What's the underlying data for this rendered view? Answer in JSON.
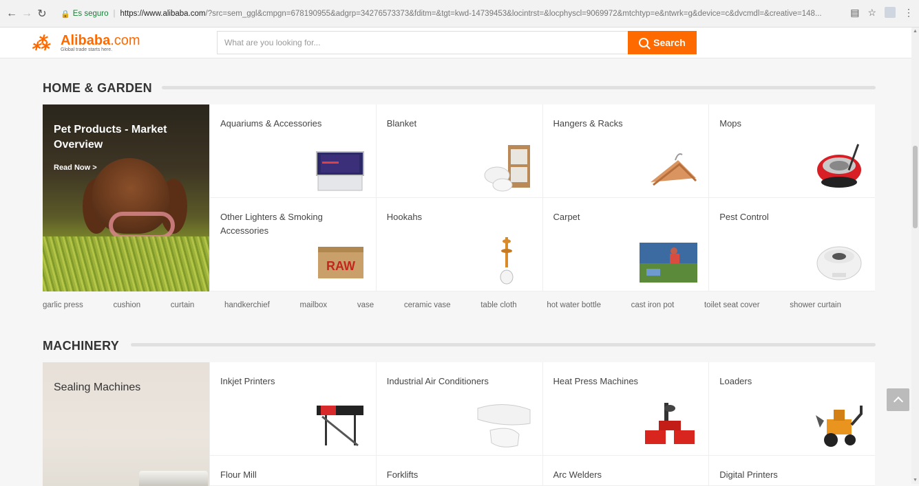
{
  "browser": {
    "secure_label": "Es seguro",
    "url_host": "https://www.alibaba.com",
    "url_rest": "/?src=sem_ggl&cmpgn=678190955&adgrp=34276573373&fditm=&tgt=kwd-14739453&locintrst=&locphyscl=9069972&mtchtyp=e&ntwrk=g&device=c&dvcmdl=&creative=148..."
  },
  "header": {
    "logo_name": "Alibaba",
    "logo_suffix": ".com",
    "logo_tagline": "Global trade starts here.",
    "search_placeholder": "What are you looking for...",
    "search_label": "Search"
  },
  "home_garden": {
    "title": "HOME & GARDEN",
    "hero_title": "Pet Products - Market Overview",
    "hero_link": "Read Now >",
    "cells": [
      {
        "label": "Aquariums & Accessories"
      },
      {
        "label": "Blanket"
      },
      {
        "label": "Hangers & Racks"
      },
      {
        "label": "Mops"
      },
      {
        "label": "Other Lighters & Smoking Accessories"
      },
      {
        "label": "Hookahs"
      },
      {
        "label": "Carpet"
      },
      {
        "label": "Pest Control"
      }
    ],
    "raw_text": "RAW",
    "keywords": [
      "garlic press",
      "cushion",
      "curtain",
      "handkerchief",
      "mailbox",
      "vase",
      "ceramic vase",
      "table cloth",
      "hot water bottle",
      "cast iron pot",
      "toilet seat cover",
      "shower curtain"
    ]
  },
  "machinery": {
    "title": "MACHINERY",
    "hero_title": "Sealing Machines",
    "cells": [
      {
        "label": "Inkjet Printers"
      },
      {
        "label": "Industrial Air Conditioners"
      },
      {
        "label": "Heat Press Machines"
      },
      {
        "label": "Loaders"
      },
      {
        "label": "Flour Mill"
      },
      {
        "label": "Forklifts"
      },
      {
        "label": "Arc Welders"
      },
      {
        "label": "Digital Printers"
      }
    ]
  },
  "colors": {
    "accent": "#ff6a00"
  }
}
